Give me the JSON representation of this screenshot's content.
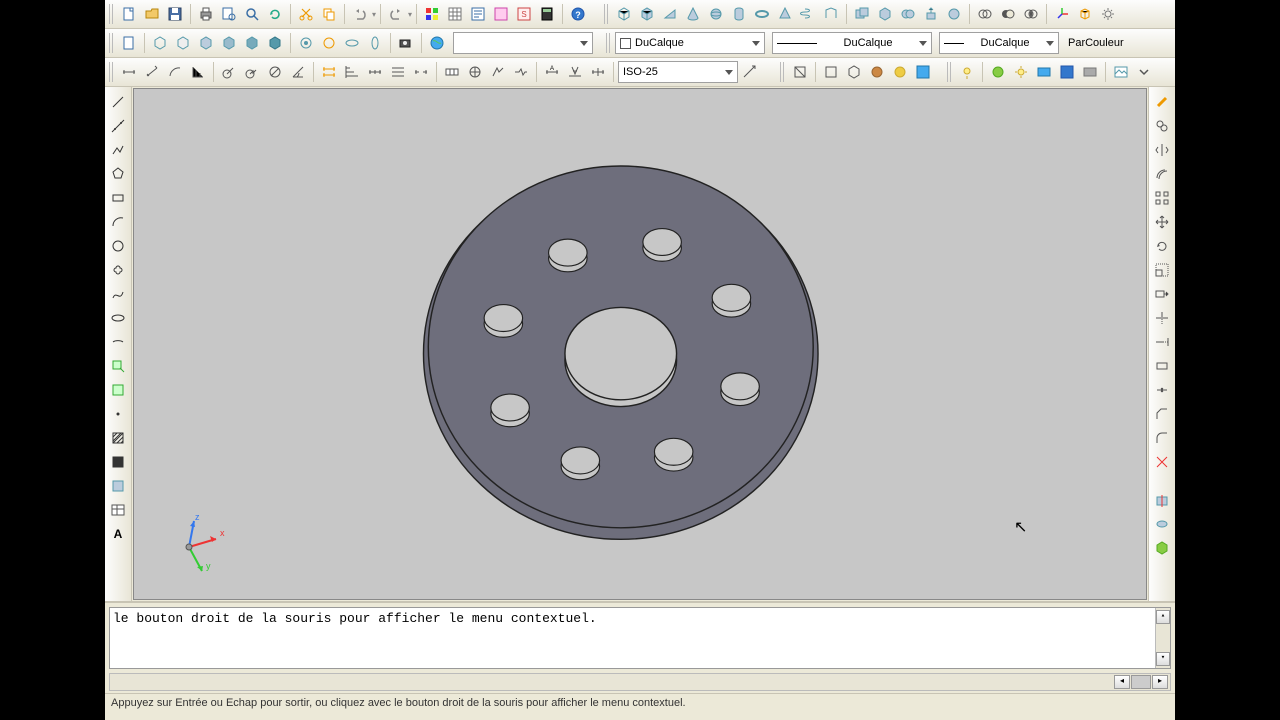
{
  "toolbars": {
    "row2": {
      "layer_combo": "DuCalque",
      "linetype_combo": "DuCalque",
      "lineweight_combo": "DuCalque",
      "color_combo": "ParCouleur"
    },
    "row3": {
      "dimstyle_combo": "ISO-25"
    }
  },
  "command": {
    "history": "le bouton droit de la souris pour afficher le menu contextuel.",
    "input": ""
  },
  "status": "Appuyez sur Entrée ou Echap pour sortir, ou cliquez avec le bouton droit de la souris pour afficher le menu contextuel.",
  "axes": {
    "x": "x",
    "y": "y",
    "z": "z"
  }
}
